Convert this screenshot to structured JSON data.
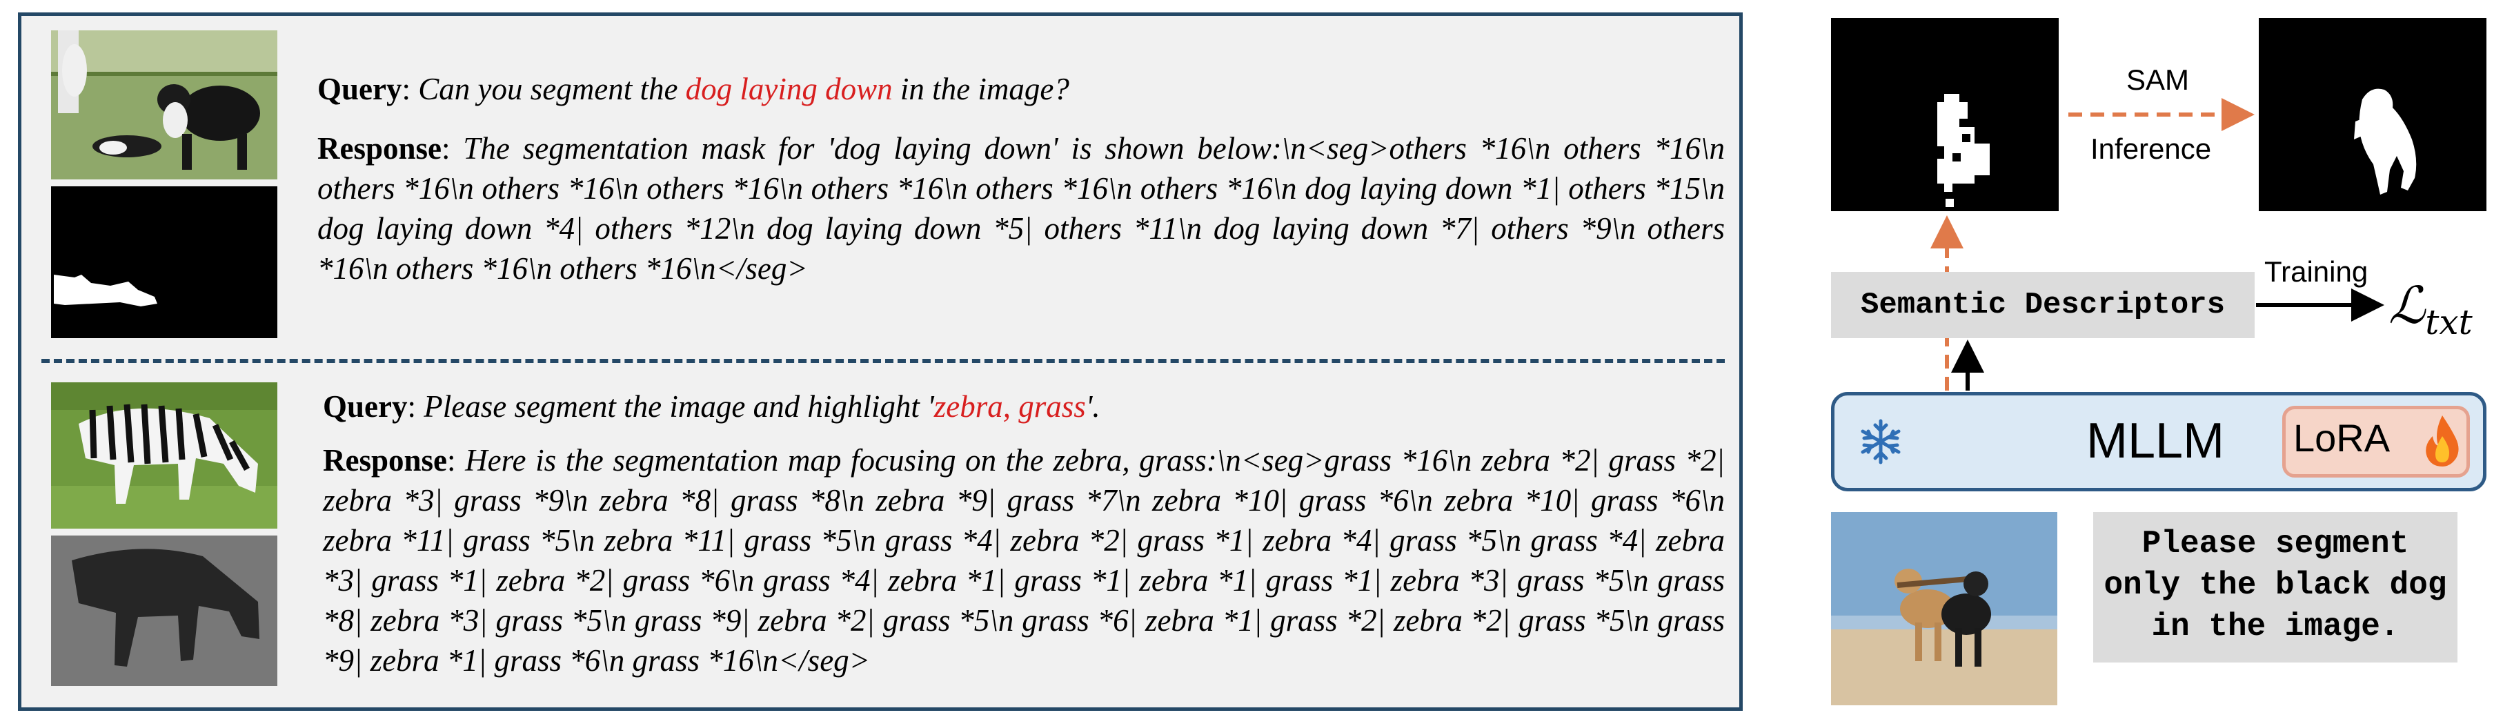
{
  "example1": {
    "query_label": "Query",
    "query_before": "Can you segment the ",
    "query_highlight": "dog laying down",
    "query_after": " in the image?",
    "response_label": "Response",
    "response_text": "The segmentation mask for 'dog laying down' is shown below:\\n<seg>others *16\\n others *16\\n others *16\\n others *16\\n others *16\\n others *16\\n others *16\\n others *16\\n dog laying down *1| others *15\\n dog laying down *4| others *12\\n dog laying down *5| others *11\\n dog laying down *7| others *9\\n others *16\\n others *16\\n others *16\\n</seg>"
  },
  "example2": {
    "query_label": "Query",
    "query_before": "Please segment the image and highlight '",
    "query_highlight": "zebra, grass",
    "query_after": "'.",
    "response_label": "Response",
    "response_text": "Here is the segmentation map focusing on the zebra, grass:\\n<seg>grass *16\\n zebra *2| grass *2| zebra *3| grass *9\\n zebra *8| grass *8\\n zebra *9| grass *7\\n zebra *10| grass *6\\n zebra *10| grass *6\\n zebra *11| grass *5\\n zebra *11| grass *5\\n grass *4| zebra *2| grass *1| zebra *4| grass *5\\n grass *4| zebra *3| grass *1| zebra *2| grass *6\\n grass *4| zebra *1| grass *1| zebra *1| grass *1| zebra *3| grass *5\\n grass *8| zebra *3| grass *5\\n grass *9| zebra *2| grass *5\\n grass *6| zebra *1| grass *2| zebra *2| grass *5\\n grass *9| zebra *1| grass *6\\n grass *16\\n</seg>"
  },
  "pipeline": {
    "sam_label": "SAM",
    "inference_label": "Inference",
    "training_label": "Training",
    "loss_symbol": "ℒ",
    "loss_subscript": "txt",
    "semantic_descriptors": "Semantic Descriptors",
    "mllm_label": "MLLM",
    "lora_label": "LoRA",
    "prompt_line1": "Please segment",
    "prompt_line2": "only the black dog",
    "prompt_line3": "in the image.",
    "snowflake_icon": "snowflake-icon",
    "fire_icon": "fire-icon"
  },
  "colors": {
    "panel_border": "#244866",
    "highlight_red": "#d81f1f",
    "arrow_orange": "#e07a4a",
    "mllm_fill": "#dbe9f5",
    "mllm_border": "#2e5a86",
    "lora_fill": "#f6d5c8"
  }
}
